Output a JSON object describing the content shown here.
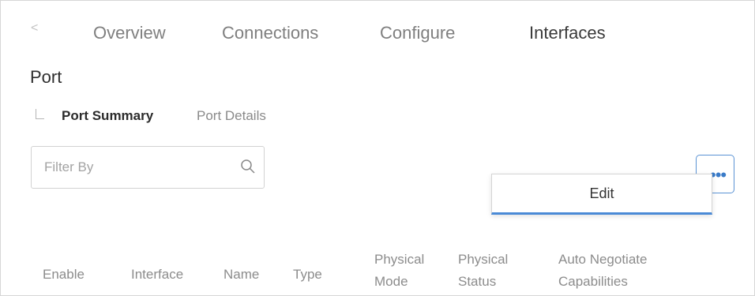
{
  "nav": {
    "back_glyph": "<",
    "tabs": [
      {
        "label": "Overview",
        "active": false
      },
      {
        "label": "Connections",
        "active": false
      },
      {
        "label": "Configure",
        "active": false
      },
      {
        "label": "Interfaces",
        "active": true
      }
    ]
  },
  "page": {
    "title": "Port"
  },
  "subnav": {
    "items": [
      {
        "label": "Port Summary",
        "active": true
      },
      {
        "label": "Port Details",
        "active": false
      }
    ]
  },
  "filter": {
    "placeholder": "Filter By",
    "value": "",
    "icon": "search-icon"
  },
  "actions": {
    "more_icon": "more-horizontal-icon",
    "more_glyph": "•••"
  },
  "menu": {
    "items": [
      {
        "label": "Edit"
      }
    ]
  },
  "table": {
    "headers": [
      {
        "line1": "Enable",
        "line2": ""
      },
      {
        "line1": "Interface",
        "line2": ""
      },
      {
        "line1": "Name",
        "line2": ""
      },
      {
        "line1": "Type",
        "line2": ""
      },
      {
        "line1": "Physical",
        "line2": "Mode"
      },
      {
        "line1": "Physical",
        "line2": "Status"
      },
      {
        "line1": "Auto Negotiate",
        "line2": "Capabilities"
      }
    ]
  },
  "colors": {
    "accent": "#3a7bc8",
    "accent_border": "#5b93d4",
    "menu_underline": "#4a8ad6"
  }
}
